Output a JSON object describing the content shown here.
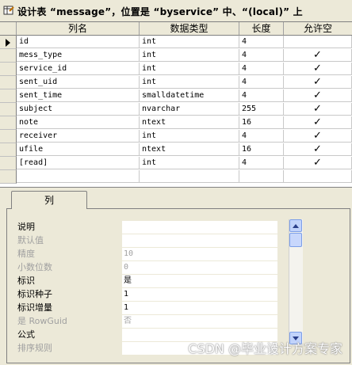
{
  "window": {
    "title": "设计表 “message”，位置是 “byservice” 中、“(local)” 上"
  },
  "grid": {
    "columns": [
      "列名",
      "数据类型",
      "长度",
      "允许空"
    ],
    "rows": [
      {
        "name": "id",
        "type": "int",
        "length": "4",
        "nullable": ""
      },
      {
        "name": "mess_type",
        "type": "int",
        "length": "4",
        "nullable": "✓"
      },
      {
        "name": "service_id",
        "type": "int",
        "length": "4",
        "nullable": "✓"
      },
      {
        "name": "sent_uid",
        "type": "int",
        "length": "4",
        "nullable": "✓"
      },
      {
        "name": "sent_time",
        "type": "smalldatetime",
        "length": "4",
        "nullable": "✓"
      },
      {
        "name": "subject",
        "type": "nvarchar",
        "length": "255",
        "nullable": "✓"
      },
      {
        "name": "note",
        "type": "ntext",
        "length": "16",
        "nullable": "✓"
      },
      {
        "name": "receiver",
        "type": "int",
        "length": "4",
        "nullable": "✓"
      },
      {
        "name": "ufile",
        "type": "ntext",
        "length": "16",
        "nullable": "✓"
      },
      {
        "name": "[read]",
        "type": "int",
        "length": "4",
        "nullable": "✓"
      },
      {
        "name": "",
        "type": "",
        "length": "",
        "nullable": ""
      }
    ]
  },
  "tab": {
    "label": "列"
  },
  "properties": [
    {
      "label": "说明",
      "value": "",
      "disabled": false
    },
    {
      "label": "默认值",
      "value": "",
      "disabled": true
    },
    {
      "label": "精度",
      "value": "10",
      "disabled": true
    },
    {
      "label": "小数位数",
      "value": "0",
      "disabled": true
    },
    {
      "label": "标识",
      "value": "是",
      "disabled": false
    },
    {
      "label": "标识种子",
      "value": "1",
      "disabled": false
    },
    {
      "label": "标识增量",
      "value": "1",
      "disabled": false
    },
    {
      "label": "是 RowGuid",
      "value": "否",
      "disabled": true
    },
    {
      "label": "公式",
      "value": "",
      "disabled": false
    },
    {
      "label": "排序规则",
      "value": "",
      "disabled": true
    }
  ],
  "watermark": "CSDN @毕业设计方案专家",
  "colors": {
    "window_bg": "#ece9d8",
    "grid_bg": "#ffffff",
    "scroll_accent": "#7b9ee8"
  },
  "icons": {
    "title": "table-design-icon",
    "row_pointer": "current-row-pointer-icon"
  }
}
